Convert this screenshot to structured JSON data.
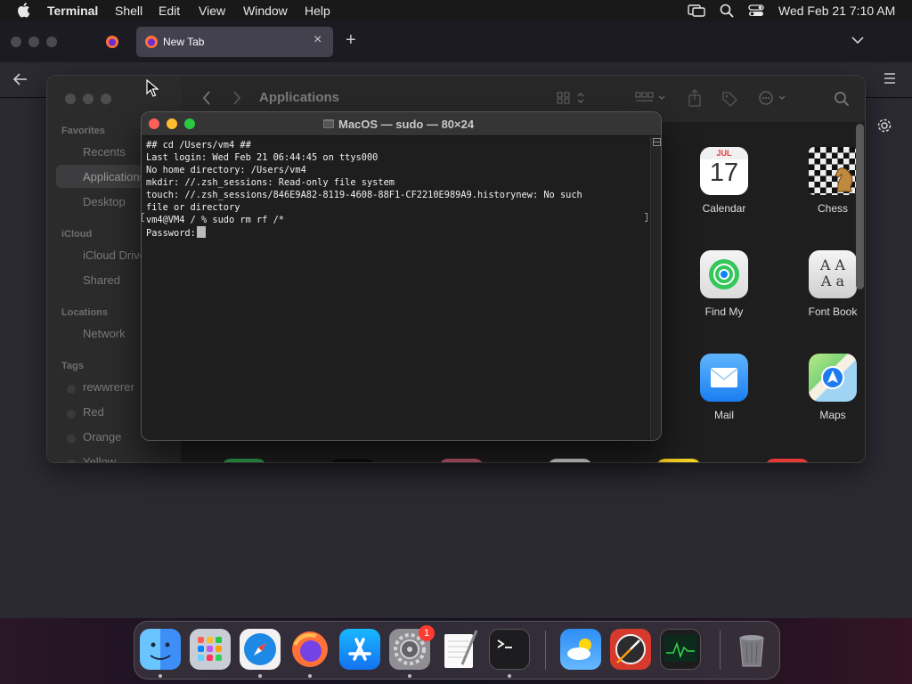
{
  "menubar": {
    "app_name": "Terminal",
    "items": [
      "Shell",
      "Edit",
      "View",
      "Window",
      "Help"
    ],
    "clock": "Wed Feb 21  7:10 AM"
  },
  "browser": {
    "tab_title": "New Tab",
    "new_tab_symbol": "+",
    "close_symbol": "×"
  },
  "finder": {
    "title": "Applications",
    "sidebar": {
      "favorites_header": "Favorites",
      "favorites": [
        "Recents",
        "Applications",
        "Desktop"
      ],
      "icloud_header": "iCloud",
      "icloud": [
        "iCloud Drive",
        "Shared"
      ],
      "locations_header": "Locations",
      "locations": [
        "Network"
      ],
      "tags_header": "Tags",
      "tags": [
        "rewwrerer",
        "Red",
        "Orange",
        "Yellow"
      ]
    },
    "apps": [
      {
        "name": "Calendar",
        "month": "JUL",
        "day": "17"
      },
      {
        "name": "Chess"
      },
      {
        "name": "Find My"
      },
      {
        "name": "Font Book",
        "glyph_top": "A A",
        "glyph_bottom": "A a"
      },
      {
        "name": "Mail"
      },
      {
        "name": "Maps"
      }
    ]
  },
  "terminal": {
    "title": "MacOS — sudo — 80×24",
    "lines": [
      "## cd /Users/vm4 ##",
      "Last login: Wed Feb 21 06:44:45 on ttys000",
      "No home directory: /Users/vm4",
      "mkdir: //.zsh_sessions: Read-only file system",
      "touch: //.zsh_sessions/846E9A82-8119-4608-88F1-CF2210E989A9.historynew: No such",
      "file or directory",
      "vm4@VM4 / % sudo rm rf /*",
      "Password:"
    ]
  },
  "dock": {
    "apps": [
      "Finder",
      "Launchpad",
      "Safari",
      "Firefox",
      "App Store",
      "System Settings",
      "TextEdit",
      "Terminal",
      "Weather",
      "Instruments",
      "Activity Monitor",
      "Trash"
    ],
    "settings_badge": "1"
  },
  "colors": {
    "traffic_red": "#ff5f57",
    "traffic_yellow": "#febc2e",
    "traffic_green": "#28c840",
    "menubar_bg": "#191919",
    "terminal_bg": "#1e1e1e"
  }
}
